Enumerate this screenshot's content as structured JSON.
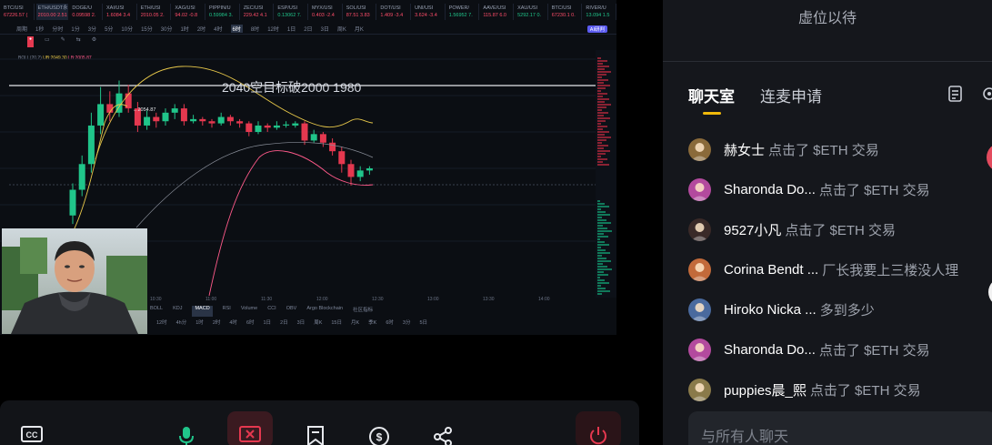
{
  "stream": {
    "tickers": [
      {
        "name": "BTC/USI",
        "price": "67226.57 (",
        "up": false
      },
      {
        "name": "ETH/USDT永续",
        "price": "2010.00 2.51%",
        "up": false,
        "active": true
      },
      {
        "name": "DOGE/U",
        "price": "0.09598 2.",
        "up": false
      },
      {
        "name": "XAI/USI",
        "price": "1.6084 3.4",
        "up": false
      },
      {
        "name": "ETH/USI",
        "price": "2010.05 2.",
        "up": false
      },
      {
        "name": "XAG/USI",
        "price": "94.02 -0.8",
        "up": false
      },
      {
        "name": "PIPPIN/U",
        "price": "0.59984 3.",
        "up": true
      },
      {
        "name": "ZEC/USI",
        "price": "229.42 4.1",
        "up": false
      },
      {
        "name": "ESP/USI",
        "price": "0.13062 7.",
        "up": true
      },
      {
        "name": "MYX/USI",
        "price": "0.403 -2.4",
        "up": false
      },
      {
        "name": "SOL/USI",
        "price": "87.51 3.83",
        "up": false
      },
      {
        "name": "DOT/USI",
        "price": "1.409 -3.4",
        "up": false
      },
      {
        "name": "UNI/USI",
        "price": "3.624 -3.4",
        "up": false
      },
      {
        "name": "POWER/",
        "price": "1.56952 7.",
        "up": true
      },
      {
        "name": "AAVE/USI",
        "price": "115.87 6.0",
        "up": false
      },
      {
        "name": "XAU/USI",
        "price": "5292.17 0.",
        "up": true
      },
      {
        "name": "BTC/USI",
        "price": "67230.1 0.",
        "up": false
      },
      {
        "name": "RIVER/U",
        "price": "13.094 1.5",
        "up": true
      }
    ],
    "timeframes": [
      "周期",
      "1秒",
      "分时",
      "1分",
      "3分",
      "5分",
      "10分",
      "15分",
      "30分",
      "1时",
      "2时",
      "4时",
      "6时",
      "8时",
      "12时",
      "1日",
      "2日",
      "3日",
      "周K",
      "月K"
    ],
    "ai_badge": "AI研判",
    "annotation": "2040空目标破2000 1980",
    "high_label": "2054.87",
    "boll_label": "BOLL(20,2)",
    "boll_upper": "UB:2049.30",
    "boll_lower": "LB:2005.87",
    "indicator_tabs": [
      "BOLL",
      "KDJ",
      "MACD",
      "RSI",
      "Volume",
      "CCI",
      "OBV",
      "Argo Blockchain",
      "社区指标"
    ],
    "indicator_selected": "MACD",
    "bottom_timeframes": [
      "12时",
      "4h分",
      "1时",
      "2时",
      "4时",
      "6时",
      "1日",
      "2日",
      "3日",
      "周K",
      "15日",
      "月K",
      "季K",
      "6时",
      "3分",
      "5日"
    ],
    "time_axis": [
      "10:30",
      "11:00",
      "11:30",
      "12:00",
      "12:30",
      "13:00",
      "13:30",
      "14:00"
    ]
  },
  "candles": [
    {
      "o": 1992,
      "c": 2004,
      "h": 2007,
      "l": 1988
    },
    {
      "o": 2004,
      "c": 2016,
      "h": 2020,
      "l": 2001
    },
    {
      "o": 2016,
      "c": 2034,
      "h": 2040,
      "l": 2012
    },
    {
      "o": 2034,
      "c": 2044,
      "h": 2052,
      "l": 2030
    },
    {
      "o": 2044,
      "c": 2040,
      "h": 2050,
      "l": 2036
    },
    {
      "o": 2040,
      "c": 2049,
      "h": 2055,
      "l": 2038
    },
    {
      "o": 2049,
      "c": 2042,
      "h": 2053,
      "l": 2040
    },
    {
      "o": 2042,
      "c": 2034,
      "h": 2045,
      "l": 2031
    },
    {
      "o": 2034,
      "c": 2038,
      "h": 2041,
      "l": 2032
    },
    {
      "o": 2038,
      "c": 2036,
      "h": 2040,
      "l": 2033
    },
    {
      "o": 2036,
      "c": 2040,
      "h": 2042,
      "l": 2034
    },
    {
      "o": 2040,
      "c": 2042,
      "h": 2044,
      "l": 2037
    },
    {
      "o": 2042,
      "c": 2036,
      "h": 2044,
      "l": 2034
    },
    {
      "o": 2036,
      "c": 2037,
      "h": 2039,
      "l": 2035
    },
    {
      "o": 2037,
      "c": 2036,
      "h": 2038,
      "l": 2034
    },
    {
      "o": 2036,
      "c": 2035,
      "h": 2037,
      "l": 2033
    },
    {
      "o": 2035,
      "c": 2038,
      "h": 2040,
      "l": 2034
    },
    {
      "o": 2038,
      "c": 2036,
      "h": 2039,
      "l": 2034
    },
    {
      "o": 2036,
      "c": 2035,
      "h": 2037,
      "l": 2033
    },
    {
      "o": 2035,
      "c": 2031,
      "h": 2036,
      "l": 2029
    },
    {
      "o": 2031,
      "c": 2034,
      "h": 2036,
      "l": 2030
    },
    {
      "o": 2034,
      "c": 2033,
      "h": 2035,
      "l": 2031
    },
    {
      "o": 2033,
      "c": 2034,
      "h": 2036,
      "l": 2032
    },
    {
      "o": 2034,
      "c": 2034.5,
      "h": 2036,
      "l": 2033
    },
    {
      "o": 2034,
      "c": 2035,
      "h": 2036,
      "l": 2033
    },
    {
      "o": 2035,
      "c": 2027,
      "h": 2036,
      "l": 2025
    },
    {
      "o": 2027,
      "c": 2030,
      "h": 2032,
      "l": 2026
    },
    {
      "o": 2030,
      "c": 2026,
      "h": 2031,
      "l": 2024
    },
    {
      "o": 2026,
      "c": 2022,
      "h": 2028,
      "l": 2020
    },
    {
      "o": 2022,
      "c": 2016,
      "h": 2024,
      "l": 2012
    },
    {
      "o": 2016,
      "c": 2010,
      "h": 2018,
      "l": 2006
    },
    {
      "o": 2010,
      "c": 2013,
      "h": 2015,
      "l": 2008
    },
    {
      "o": 2013,
      "c": 2014,
      "h": 2015,
      "l": 2011
    }
  ],
  "controls": {
    "cc_label": "CC"
  },
  "panel": {
    "status": "虚位以待",
    "tabs": [
      "聊天室",
      "连麦申请"
    ],
    "chat_placeholder": "与所有人聊天",
    "messages": [
      {
        "user": "赫女士",
        "text": "点击了 $ETH 交易",
        "avatar_color": "#8a6a3a"
      },
      {
        "user": "Sharonda Do...",
        "text": "点击了 $ETH 交易",
        "avatar_color": "#b34a9e"
      },
      {
        "user": "9527小凡",
        "text": "点击了 $ETH 交易",
        "avatar_color": "#3a2a28"
      },
      {
        "user": "Corina Bendt ...",
        "text": "厂长我要上三楼没人理",
        "avatar_color": "#c26a3a"
      },
      {
        "user": "Hiroko Nicka ...",
        "text": "多到多少",
        "avatar_color": "#4a6a9e"
      },
      {
        "user": "Sharonda Do...",
        "text": "点击了 $ETH 交易",
        "avatar_color": "#b34a9e"
      },
      {
        "user": "puppies晨_熙",
        "text": "点击了 $ETH 交易",
        "avatar_color": "#8a7a4a"
      }
    ]
  },
  "colors": {
    "up": "#20c58a",
    "down": "#e5384f",
    "accent": "#f0b90b",
    "boll_upper": "#e8c84a",
    "boll_lower": "#ff5a8a"
  }
}
